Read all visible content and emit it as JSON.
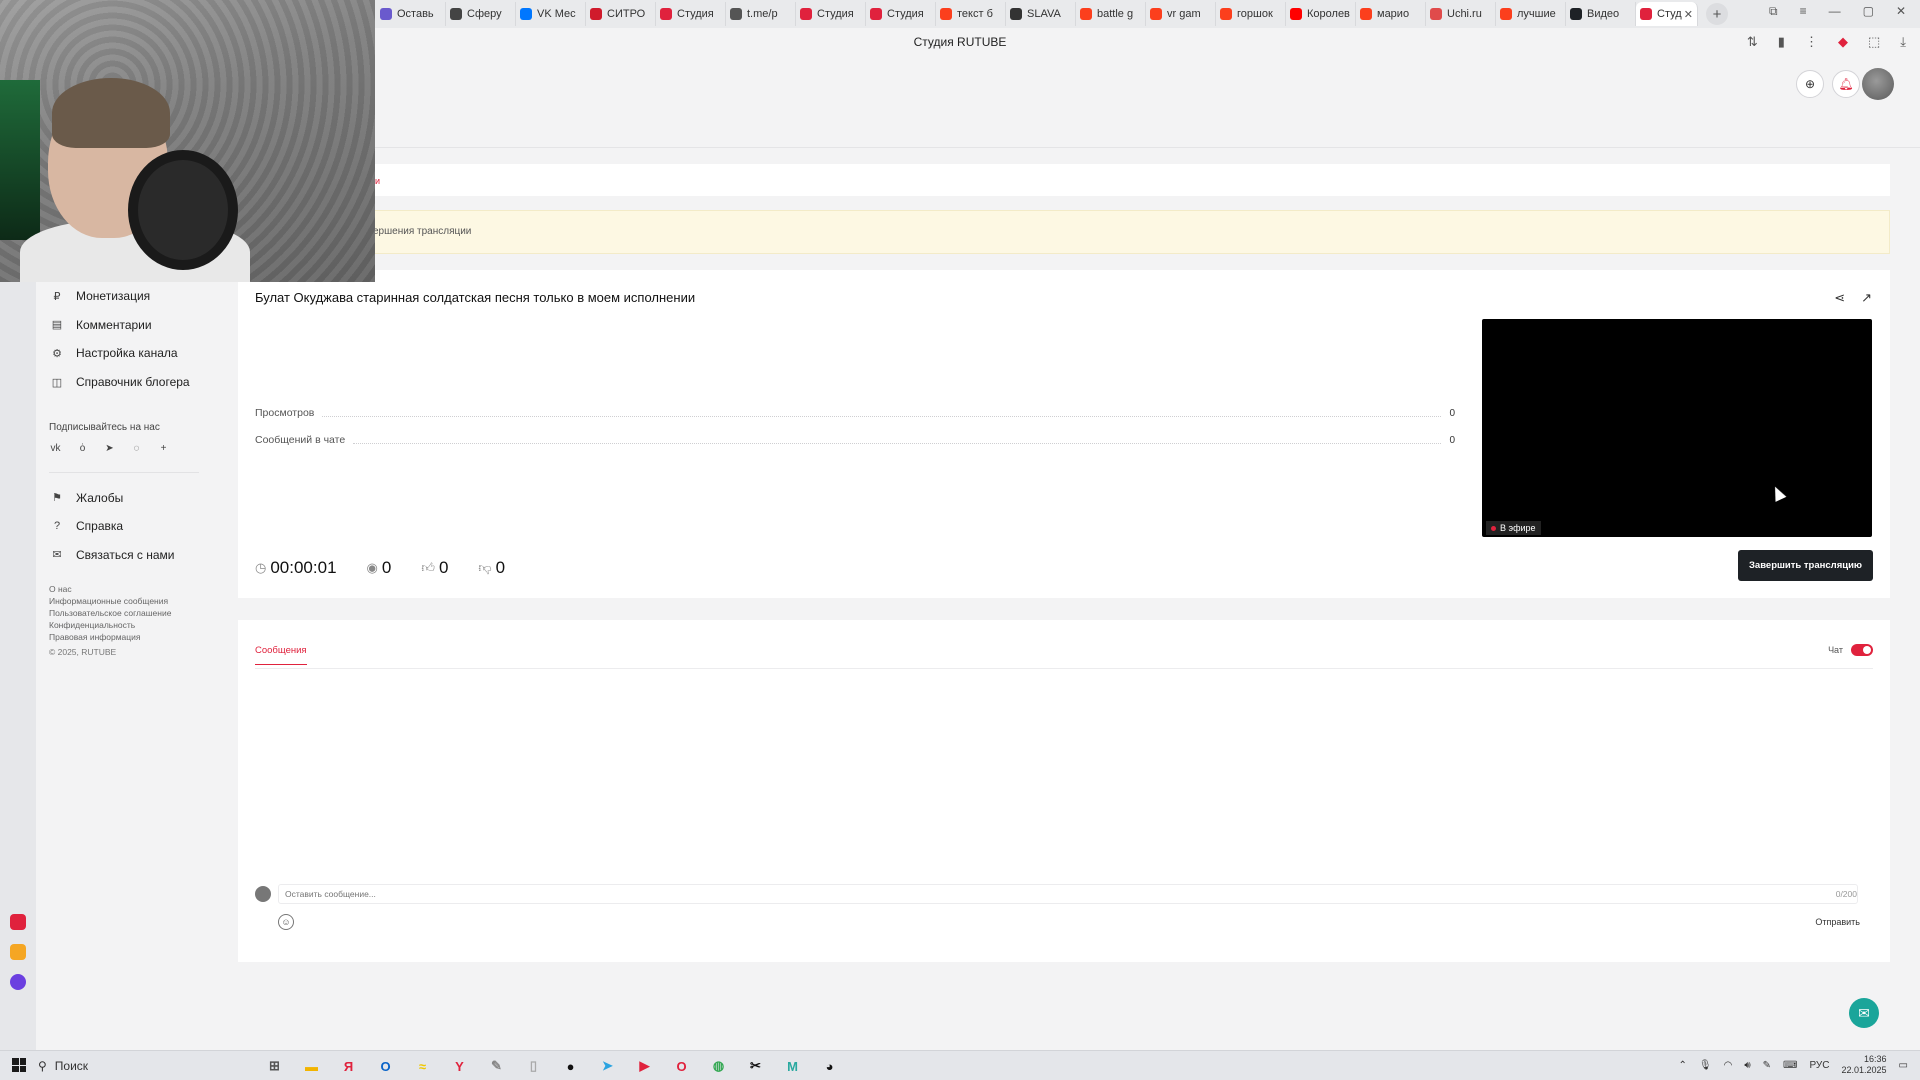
{
  "browser": {
    "window_title": "Студия RUTUBE",
    "tabs": [
      {
        "label": "Оставь",
        "color": "#6a5acd"
      },
      {
        "label": "Сферу",
        "color": "#444444"
      },
      {
        "label": "VK Мес",
        "color": "#0077ff"
      },
      {
        "label": "СИТРО",
        "color": "#d01b2c"
      },
      {
        "label": "Студия",
        "color": "#e0223d"
      },
      {
        "label": "t.me/p",
        "color": "#555555"
      },
      {
        "label": "Студия",
        "color": "#e0223d"
      },
      {
        "label": "Студия",
        "color": "#e0223d"
      },
      {
        "label": "текст б",
        "color": "#fc3f1d"
      },
      {
        "label": "SLAVA",
        "color": "#333333"
      },
      {
        "label": "battle g",
        "color": "#fc3f1d"
      },
      {
        "label": "vr gam",
        "color": "#fc3f1d"
      },
      {
        "label": "горшок",
        "color": "#fc3f1d"
      },
      {
        "label": "Королев",
        "color": "#ff0000"
      },
      {
        "label": "марио",
        "color": "#fc3f1d"
      },
      {
        "label": "Uchi.ru",
        "color": "#e04b4b"
      },
      {
        "label": "лучшие",
        "color": "#fc3f1d"
      },
      {
        "label": "Видео",
        "color": "#1e2226"
      }
    ],
    "active_tab": {
      "label": "Студ",
      "color": "#e0223d"
    }
  },
  "notice_text": "ершения трансляции",
  "subtab_active": "ии",
  "sidebar": {
    "items": [
      {
        "label": "Монетизация",
        "icon": "monetization-icon"
      },
      {
        "label": "Комментарии",
        "icon": "comments-icon"
      },
      {
        "label": "Настройка канала",
        "icon": "settings-icon"
      },
      {
        "label": "Справочник блогера",
        "icon": "guide-icon"
      }
    ],
    "follow_label": "Подписывайтесь на нас",
    "socials": [
      "vk",
      "ok",
      "telegram",
      "viber",
      "+"
    ],
    "items2": [
      {
        "label": "Жалобы",
        "icon": "flag-icon"
      },
      {
        "label": "Справка",
        "icon": "help-icon"
      },
      {
        "label": "Связаться с нами",
        "icon": "mail-icon"
      }
    ],
    "footer_links": [
      "О нас",
      "Информационные сообщения",
      "Пользовательское соглашение",
      "Конфиденциальность",
      "Правовая информация"
    ],
    "copyright": "© 2025, RUTUBE"
  },
  "stream": {
    "title": "Булат Окуджава старинная солдатская песня только в моем исполнении",
    "stats": [
      {
        "label": "Просмотров",
        "value": "0"
      },
      {
        "label": "Сообщений в чате",
        "value": "0"
      }
    ],
    "live_badge": "В эфире",
    "duration": "00:00:01",
    "viewers": "0",
    "likes": "0",
    "dislikes": "0",
    "end_button": "Завершить трансляцию"
  },
  "chat": {
    "tab_label": "Сообщения",
    "toggle_label": "Чат",
    "chat_enabled": true,
    "input_placeholder": "Оставить сообщение...",
    "counter": "0/200",
    "send_label": "Отправить"
  },
  "taskbar": {
    "search_label": "Поиск",
    "lang": "РУС",
    "time": "16:36",
    "date": "22.01.2025"
  },
  "colors": {
    "accent": "#e0223d",
    "dark_button": "#1e2226",
    "notice_bg": "#fdf8e3"
  }
}
